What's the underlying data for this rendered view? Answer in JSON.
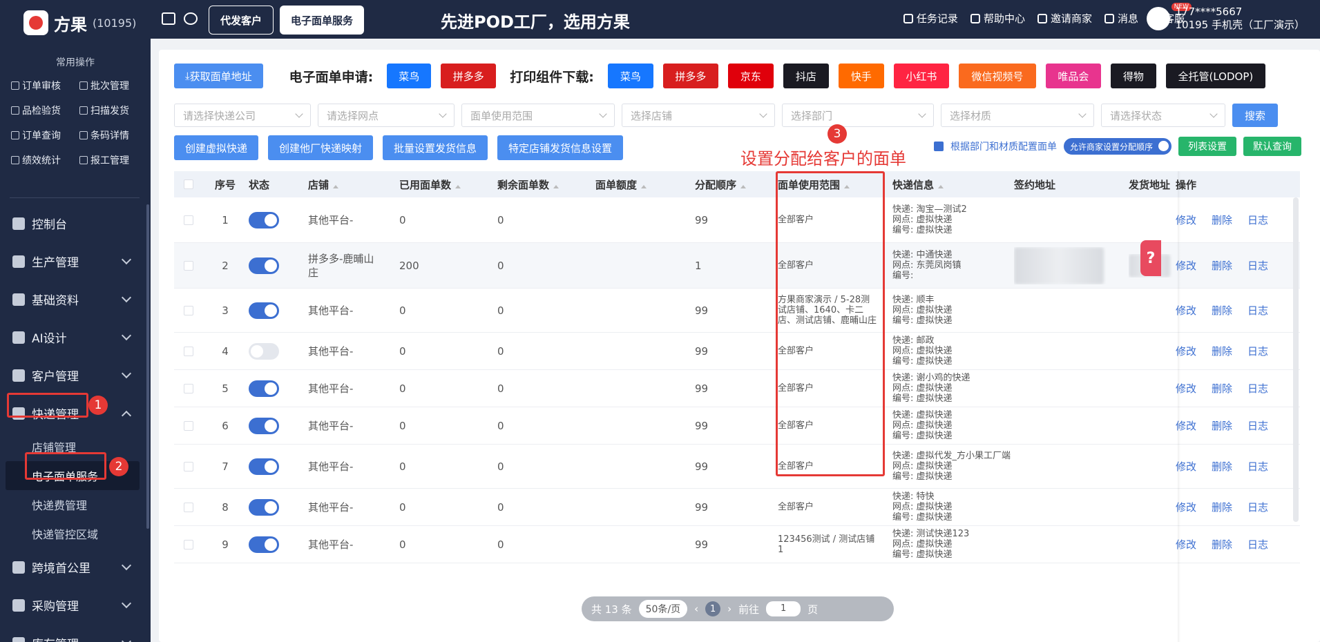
{
  "app": {
    "name": "方果",
    "account_id": "(10195)"
  },
  "sidebar": {
    "quick_title": "常用操作",
    "quick_items": [
      "订单审核",
      "批次管理",
      "品检验货",
      "扫描发货",
      "订单查询",
      "条码详情",
      "绩效统计",
      "报工管理"
    ],
    "menu": [
      {
        "label": "控制台"
      },
      {
        "label": "生产管理"
      },
      {
        "label": "基础资料"
      },
      {
        "label": "AI设计"
      },
      {
        "label": "客户管理"
      },
      {
        "label": "快递管理"
      }
    ],
    "sub_items": [
      "店铺管理",
      "电子面单服务",
      "快递费管理",
      "快递管控区域"
    ],
    "menu_after": [
      {
        "label": "跨境首公里"
      },
      {
        "label": "采购管理"
      },
      {
        "label": "库存管理"
      }
    ]
  },
  "topbar": {
    "tabs": [
      "代发客户",
      "电子面单服务"
    ],
    "slogan": "先进POD工厂，选用方果",
    "links": [
      "任务记录",
      "帮助中心",
      "邀请商家",
      "消息",
      "客服"
    ],
    "new_badge": "NEW",
    "user_line1": "177****5667",
    "user_line2": "10195 手机壳（工厂演示）"
  },
  "toolbar": {
    "get_address": "获取面单地址",
    "apply_label": "电子面单申请:",
    "apply_buttons": [
      {
        "label": "菜鸟",
        "color": "#1677ff"
      },
      {
        "label": "拼多多",
        "color": "#d81e1e"
      }
    ],
    "print_label": "打印组件下载:",
    "print_buttons": [
      {
        "label": "菜鸟",
        "color": "#1677ff"
      },
      {
        "label": "拼多多",
        "color": "#d81e1e"
      },
      {
        "label": "京东",
        "color": "#e0000b"
      },
      {
        "label": "抖店",
        "color": "#1a1a22"
      },
      {
        "label": "快手",
        "color": "#ff6a00"
      },
      {
        "label": "小红书",
        "color": "#ff2442"
      },
      {
        "label": "微信视频号",
        "color": "#fa6a1e"
      },
      {
        "label": "唯品会",
        "color": "#e8348e"
      },
      {
        "label": "得物",
        "color": "#1a1a22"
      },
      {
        "label": "全托管(LODOP)",
        "color": "#1a1a22"
      }
    ]
  },
  "filters": {
    "placeholders": [
      "请选择快递公司",
      "请选择网点",
      "面单使用范围",
      "选择店铺",
      "选择部门",
      "选择材质",
      "请选择状态"
    ],
    "search": "搜索"
  },
  "actions": [
    "创建虚拟快递",
    "创建他厂快递映射",
    "批量设置发货信息",
    "特定店铺发货信息设置"
  ],
  "right_controls": {
    "checkbox_label": "根据部门和材质配置面单",
    "toggle_label": "允许商家设置分配顺序",
    "list_settings": "列表设置",
    "default_query": "默认查询"
  },
  "annotations": {
    "n1": "1",
    "n2": "2",
    "n3": "3",
    "note": "设置分配给客户的面单"
  },
  "table": {
    "headers": [
      "序号",
      "状态",
      "店铺",
      "已用面单数",
      "剩余面单数",
      "面单额度",
      "分配顺序",
      "面单使用范围",
      "快递信息",
      "签约地址",
      "发货地址",
      "操作"
    ],
    "op_labels": [
      "修改",
      "删除",
      "日志"
    ],
    "rows": [
      {
        "no": "1",
        "on": true,
        "shop": "其他平台-",
        "used": "0",
        "left": "0",
        "quota": "",
        "order": "99",
        "scope": "全部客户",
        "express": [
          "快递: 淘宝—测试2",
          "网点: 虚拟快递",
          "编号: 虚拟快递"
        ],
        "blur": false
      },
      {
        "no": "2",
        "on": true,
        "shop": "拼多多-鹿晡山庄",
        "used": "200",
        "left": "0",
        "quota": "",
        "order": "1",
        "scope": "全部客户",
        "express": [
          "快递: 中通快递",
          "网点: 东莞凤岗镇",
          "编号:"
        ],
        "blur": true
      },
      {
        "no": "3",
        "on": true,
        "shop": "其他平台-",
        "used": "0",
        "left": "0",
        "quota": "",
        "order": "99",
        "scope": "方果商家演示 / 5-28测试店铺、1640、卡二店、测试店铺、鹿晡山庄",
        "express": [
          "快递: 顺丰",
          "网点: 虚拟快递",
          "编号: 虚拟快递"
        ],
        "blur": false
      },
      {
        "no": "4",
        "on": false,
        "shop": "其他平台-",
        "used": "0",
        "left": "0",
        "quota": "",
        "order": "99",
        "scope": "全部客户",
        "express": [
          "快递: 邮政",
          "网点: 虚拟快递",
          "编号: 虚拟快递"
        ],
        "blur": false
      },
      {
        "no": "5",
        "on": true,
        "shop": "其他平台-",
        "used": "0",
        "left": "0",
        "quota": "",
        "order": "99",
        "scope": "全部客户",
        "express": [
          "快递: 谢小鸡的快递",
          "网点: 虚拟快递",
          "编号: 虚拟快递"
        ],
        "blur": false
      },
      {
        "no": "6",
        "on": true,
        "shop": "其他平台-",
        "used": "0",
        "left": "0",
        "quota": "",
        "order": "99",
        "scope": "全部客户",
        "express": [
          "快递: 虚拟快递",
          "网点: 虚拟快递",
          "编号: 虚拟快递"
        ],
        "blur": false
      },
      {
        "no": "7",
        "on": true,
        "shop": "其他平台-",
        "used": "0",
        "left": "0",
        "quota": "",
        "order": "99",
        "scope": "全部客户",
        "express": [
          "快递: 虚拟代发_方小果工厂端",
          "网点: 虚拟快递",
          "编号: 虚拟快递"
        ],
        "blur": false
      },
      {
        "no": "8",
        "on": true,
        "shop": "其他平台-",
        "used": "0",
        "left": "0",
        "quota": "",
        "order": "99",
        "scope": "全部客户",
        "express": [
          "快递: 特快",
          "网点: 虚拟快递",
          "编号: 虚拟快递"
        ],
        "blur": false
      },
      {
        "no": "9",
        "on": true,
        "shop": "其他平台-",
        "used": "0",
        "left": "0",
        "quota": "",
        "order": "99",
        "scope": "123456测试 / 测试店铺1",
        "express": [
          "快递: 测试快递123",
          "网点: 虚拟快递",
          "编号: 虚拟快递"
        ],
        "blur": false
      }
    ]
  },
  "pager": {
    "total": "共 13 条",
    "size": "50条/页",
    "page": "1",
    "goto_prefix": "前往",
    "goto_value": "1",
    "goto_suffix": "页"
  }
}
